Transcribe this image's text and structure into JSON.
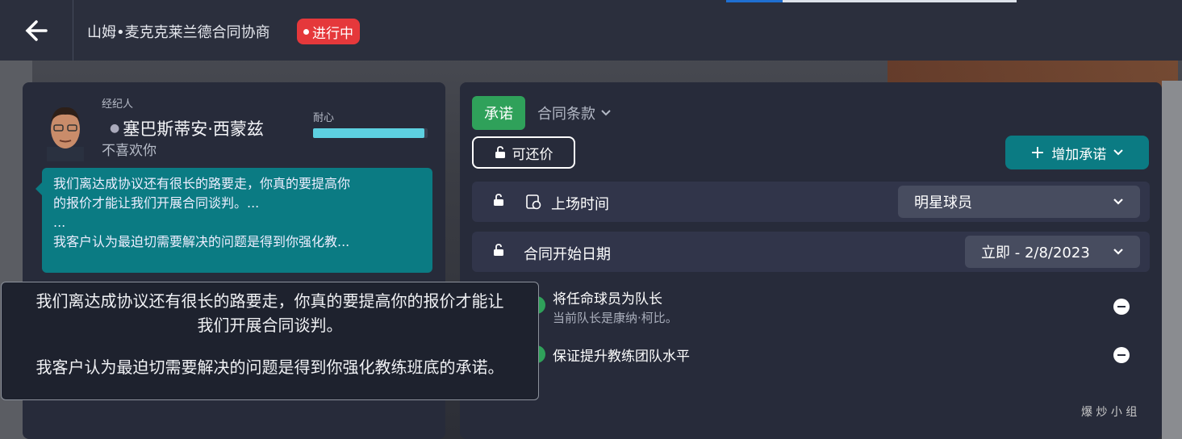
{
  "header": {
    "title": "山姆•麦克克莱兰德合同协商",
    "status": "进行中"
  },
  "agent": {
    "role_label": "经纪人",
    "name": "塞巴斯蒂安·西蒙兹",
    "mood": "不喜欢你",
    "patience_label": "耐心",
    "patience_level": 0.97
  },
  "bubble": {
    "line1": "我们离达成协议还有很长的路要走，你真的要提高你",
    "line2": "的报价才能让我们开展合同谈判。...",
    "line3": "...",
    "line4": "我客户认为最迫切需要解决的问题是得到你强化教..."
  },
  "tabs": {
    "promises": "承诺",
    "contract_terms": "合同条款"
  },
  "negotiable": "可还价",
  "add_promise": "增加承诺",
  "terms": [
    {
      "label": "上场时间",
      "value": "明星球员"
    },
    {
      "label": "合同开始日期",
      "value": "立即 - 2/8/2023"
    }
  ],
  "promises": [
    {
      "title": "将任命球员为队长",
      "subtitle": "当前队长是康纳·柯比。"
    },
    {
      "title": "保证提升教练团队水平",
      "subtitle": ""
    }
  ],
  "tooltip": {
    "line1": "我们离达成协议还有很长的路要走，你真的要提高你的报价才能让",
    "line2": "我们开展合同谈判。",
    "line3": "我客户认为最迫切需要解决的问题是得到你强化教练班底的承诺。"
  },
  "watermark": "爆 炒 小 组"
}
